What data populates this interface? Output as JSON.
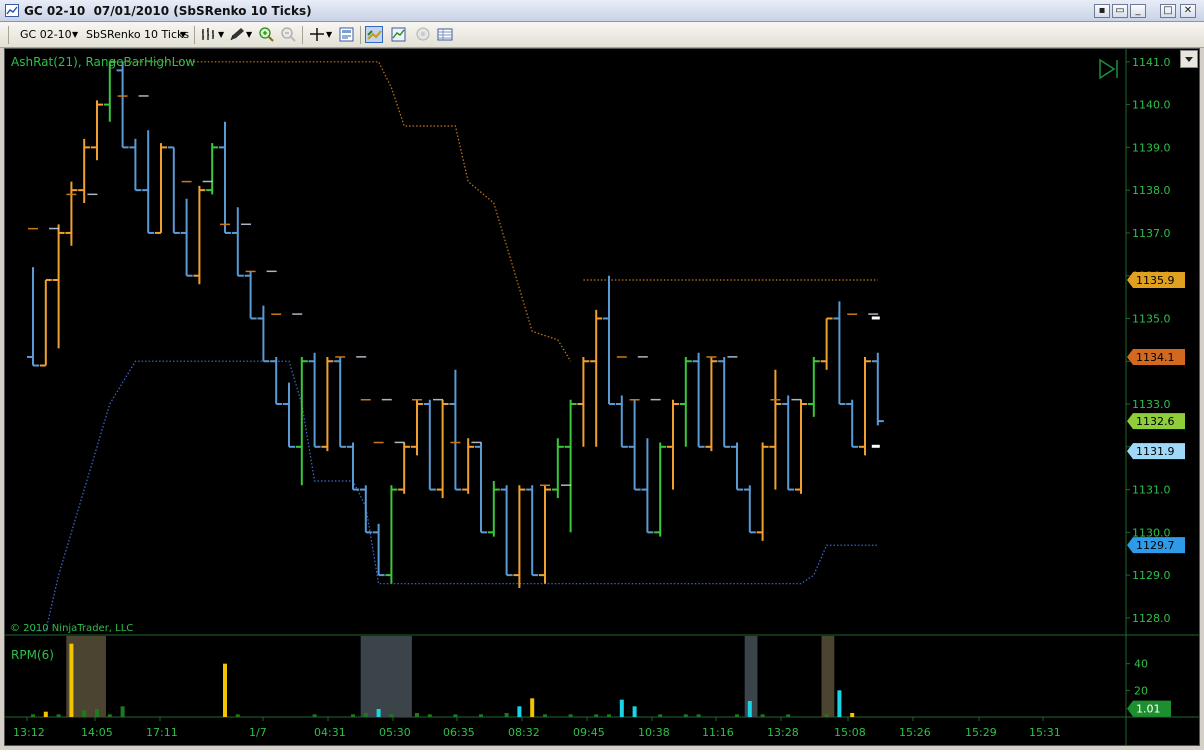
{
  "window": {
    "title": "GC 02-10  07/01/2010 (SbSRenko 10 Ticks)",
    "buttons": [
      "□",
      "▭",
      "✕"
    ]
  },
  "toolbar": {
    "instrument": "GC 02-10",
    "bar_type": "SbSRenko 10 Ticks"
  },
  "icons": [
    "chart-icon",
    "bar-style-icon",
    "drawing-tool-icon",
    "zoom-in-icon",
    "zoom-out-icon",
    "crosshair-icon",
    "properties-icon",
    "data-box-icon",
    "indicator-icon",
    "strategy-icon",
    "grid-icon"
  ],
  "panel_price": {
    "indicator_label": "AshRat(21), RangeBarHighLow",
    "copyright": "© 2010 NinjaTrader, LLC",
    "ticks": [
      "1141.0",
      "1140.0",
      "1139.0",
      "1138.0",
      "1137.0",
      "1136.0",
      "1135.0",
      "1134.0",
      "1133.0",
      "1132.0",
      "1131.0",
      "1130.0",
      "1129.0",
      "1128.0"
    ],
    "tags": [
      {
        "text": "1135.9",
        "color": "#e0a020"
      },
      {
        "text": "1134.1",
        "color": "#d2691e"
      },
      {
        "text": "1132.6",
        "color": "#8fce3a"
      },
      {
        "text": "1131.9",
        "color": "#9fd9f7"
      },
      {
        "text": "1129.7",
        "color": "#2f9be8"
      }
    ]
  },
  "panel_volume": {
    "label": "RPM(6)",
    "ticks": [
      "40",
      "20"
    ],
    "value_tag": "1.01"
  },
  "time_axis": [
    "13:12",
    "14:05",
    "17:11",
    "1/7",
    "04:31",
    "05:30",
    "06:35",
    "08:32",
    "09:45",
    "10:38",
    "11:16",
    "13:28",
    "15:08",
    "15:26",
    "15:29",
    "15:31"
  ],
  "chart_data": {
    "type": "ohlc",
    "y_range": [
      1127.6,
      1141.3
    ],
    "colors": {
      "up": "#f0a030",
      "down": "#5b9bd5",
      "strong_up": "#3cc83c",
      "hl_line": "#c97a18",
      "stop_line": "#3d6fd6",
      "axis_text": "#2fbf4a"
    },
    "bars": [
      {
        "o": 1134.1,
        "h": 1136.2,
        "l": 1133.9,
        "c": 1133.9
      },
      {
        "o": 1133.9,
        "h": 1135.9,
        "l": 1133.9,
        "c": 1135.9
      },
      {
        "o": 1135.9,
        "h": 1137.2,
        "l": 1134.3,
        "c": 1137.0
      },
      {
        "o": 1137.0,
        "h": 1138.2,
        "l": 1136.7,
        "c": 1138.0
      },
      {
        "o": 1138.0,
        "h": 1139.2,
        "l": 1137.7,
        "c": 1139.0
      },
      {
        "o": 1139.0,
        "h": 1140.1,
        "l": 1138.7,
        "c": 1140.0
      },
      {
        "o": 1140.0,
        "h": 1141.0,
        "l": 1139.6,
        "c": 1141.0
      },
      {
        "o": 1140.8,
        "h": 1141.0,
        "l": 1139.0,
        "c": 1139.0
      },
      {
        "o": 1139.0,
        "h": 1139.2,
        "l": 1138.0,
        "c": 1138.0
      },
      {
        "o": 1138.0,
        "h": 1139.4,
        "l": 1137.0,
        "c": 1137.0
      },
      {
        "o": 1137.0,
        "h": 1139.1,
        "l": 1137.0,
        "c": 1139.0
      },
      {
        "o": 1139.0,
        "h": 1139.0,
        "l": 1137.0,
        "c": 1137.0
      },
      {
        "o": 1137.0,
        "h": 1137.8,
        "l": 1136.0,
        "c": 1136.0
      },
      {
        "o": 1136.0,
        "h": 1138.1,
        "l": 1135.8,
        "c": 1138.0
      },
      {
        "o": 1138.0,
        "h": 1139.1,
        "l": 1137.9,
        "c": 1139.0
      },
      {
        "o": 1139.0,
        "h": 1139.6,
        "l": 1137.0,
        "c": 1137.0
      },
      {
        "o": 1137.0,
        "h": 1137.6,
        "l": 1136.0,
        "c": 1136.0
      },
      {
        "o": 1136.0,
        "h": 1136.1,
        "l": 1135.0,
        "c": 1135.0
      },
      {
        "o": 1135.0,
        "h": 1135.3,
        "l": 1134.0,
        "c": 1134.0
      },
      {
        "o": 1134.0,
        "h": 1134.1,
        "l": 1133.0,
        "c": 1133.0
      },
      {
        "o": 1133.0,
        "h": 1133.5,
        "l": 1132.0,
        "c": 1132.0
      },
      {
        "o": 1132.0,
        "h": 1134.1,
        "l": 1131.1,
        "c": 1134.0
      },
      {
        "o": 1134.0,
        "h": 1134.2,
        "l": 1132.0,
        "c": 1132.0
      },
      {
        "o": 1132.0,
        "h": 1134.1,
        "l": 1131.9,
        "c": 1134.0
      },
      {
        "o": 1134.0,
        "h": 1134.1,
        "l": 1132.0,
        "c": 1132.0
      },
      {
        "o": 1132.0,
        "h": 1132.1,
        "l": 1131.0,
        "c": 1131.0
      },
      {
        "o": 1131.0,
        "h": 1131.1,
        "l": 1130.0,
        "c": 1130.0
      },
      {
        "o": 1130.0,
        "h": 1130.2,
        "l": 1129.0,
        "c": 1129.0
      },
      {
        "o": 1129.0,
        "h": 1131.1,
        "l": 1128.8,
        "c": 1131.0
      },
      {
        "o": 1131.0,
        "h": 1132.1,
        "l": 1130.9,
        "c": 1132.0
      },
      {
        "o": 1132.0,
        "h": 1133.1,
        "l": 1131.8,
        "c": 1133.0
      },
      {
        "o": 1133.0,
        "h": 1133.1,
        "l": 1131.0,
        "c": 1131.0
      },
      {
        "o": 1131.0,
        "h": 1133.1,
        "l": 1130.8,
        "c": 1133.0
      },
      {
        "o": 1133.0,
        "h": 1133.8,
        "l": 1131.0,
        "c": 1131.0
      },
      {
        "o": 1131.0,
        "h": 1132.2,
        "l": 1130.9,
        "c": 1132.0
      },
      {
        "o": 1132.0,
        "h": 1132.1,
        "l": 1130.0,
        "c": 1130.0
      },
      {
        "o": 1130.0,
        "h": 1131.2,
        "l": 1129.9,
        "c": 1131.0
      },
      {
        "o": 1131.0,
        "h": 1131.1,
        "l": 1129.0,
        "c": 1129.0
      },
      {
        "o": 1129.0,
        "h": 1131.1,
        "l": 1128.7,
        "c": 1131.0
      },
      {
        "o": 1131.0,
        "h": 1131.1,
        "l": 1129.0,
        "c": 1129.0
      },
      {
        "o": 1129.0,
        "h": 1131.1,
        "l": 1128.8,
        "c": 1131.0
      },
      {
        "o": 1131.0,
        "h": 1132.2,
        "l": 1130.8,
        "c": 1132.0
      },
      {
        "o": 1132.0,
        "h": 1133.1,
        "l": 1130.0,
        "c": 1133.0
      },
      {
        "o": 1133.0,
        "h": 1134.1,
        "l": 1132.0,
        "c": 1134.0
      },
      {
        "o": 1134.0,
        "h": 1135.2,
        "l": 1132.0,
        "c": 1135.0
      },
      {
        "o": 1135.0,
        "h": 1136.0,
        "l": 1133.0,
        "c": 1133.0
      },
      {
        "o": 1133.0,
        "h": 1133.2,
        "l": 1132.0,
        "c": 1132.0
      },
      {
        "o": 1132.0,
        "h": 1133.1,
        "l": 1131.0,
        "c": 1131.0
      },
      {
        "o": 1131.0,
        "h": 1132.2,
        "l": 1130.0,
        "c": 1130.0
      },
      {
        "o": 1130.0,
        "h": 1132.1,
        "l": 1129.9,
        "c": 1132.0
      },
      {
        "o": 1132.0,
        "h": 1133.1,
        "l": 1131.0,
        "c": 1133.0
      },
      {
        "o": 1133.0,
        "h": 1134.1,
        "l": 1132.0,
        "c": 1134.0
      },
      {
        "o": 1134.0,
        "h": 1134.2,
        "l": 1132.0,
        "c": 1132.0
      },
      {
        "o": 1132.0,
        "h": 1134.1,
        "l": 1131.9,
        "c": 1134.0
      },
      {
        "o": 1134.0,
        "h": 1134.1,
        "l": 1132.0,
        "c": 1132.0
      },
      {
        "o": 1132.0,
        "h": 1132.1,
        "l": 1131.0,
        "c": 1131.0
      },
      {
        "o": 1131.0,
        "h": 1131.1,
        "l": 1130.0,
        "c": 1130.0
      },
      {
        "o": 1130.0,
        "h": 1132.1,
        "l": 1129.8,
        "c": 1132.0
      },
      {
        "o": 1132.0,
        "h": 1133.8,
        "l": 1131.0,
        "c": 1133.0
      },
      {
        "o": 1133.0,
        "h": 1133.2,
        "l": 1131.0,
        "c": 1131.0
      },
      {
        "o": 1131.0,
        "h": 1133.1,
        "l": 1130.9,
        "c": 1133.0
      },
      {
        "o": 1133.0,
        "h": 1134.1,
        "l": 1132.7,
        "c": 1134.0
      },
      {
        "o": 1134.0,
        "h": 1135.0,
        "l": 1133.8,
        "c": 1135.0
      },
      {
        "o": 1135.0,
        "h": 1135.4,
        "l": 1133.0,
        "c": 1133.0
      },
      {
        "o": 1133.0,
        "h": 1133.1,
        "l": 1132.0,
        "c": 1132.0
      },
      {
        "o": 1132.0,
        "h": 1134.1,
        "l": 1131.8,
        "c": 1134.0
      },
      {
        "o": 1134.0,
        "h": 1134.2,
        "l": 1132.5,
        "c": 1132.6
      }
    ],
    "hl_marks": [
      {
        "i": 0,
        "v": 1137.1
      },
      {
        "i": 3,
        "v": 1137.9
      },
      {
        "i": 7,
        "v": 1140.2
      },
      {
        "i": 12,
        "v": 1138.2
      },
      {
        "i": 15,
        "v": 1137.2
      },
      {
        "i": 17,
        "v": 1136.1
      },
      {
        "i": 19,
        "v": 1135.1
      },
      {
        "i": 24,
        "v": 1134.1
      },
      {
        "i": 26,
        "v": 1133.1
      },
      {
        "i": 27,
        "v": 1132.1
      },
      {
        "i": 30,
        "v": 1133.1
      },
      {
        "i": 33,
        "v": 1132.1
      },
      {
        "i": 40,
        "v": 1131.1
      },
      {
        "i": 46,
        "v": 1134.1
      },
      {
        "i": 47,
        "v": 1133.1
      },
      {
        "i": 53,
        "v": 1134.1
      },
      {
        "i": 58,
        "v": 1133.1
      },
      {
        "i": 64,
        "v": 1135.1
      }
    ],
    "upper_line": [
      {
        "i": 6,
        "v": 1141.0
      },
      {
        "i": 27,
        "v": 1141.0
      },
      {
        "i": 28,
        "v": 1140.4
      },
      {
        "i": 29,
        "v": 1139.5
      },
      {
        "i": 33,
        "v": 1139.5
      },
      {
        "i": 34,
        "v": 1138.2
      },
      {
        "i": 36,
        "v": 1137.7
      },
      {
        "i": 38,
        "v": 1135.7
      },
      {
        "i": 39,
        "v": 1134.7
      },
      {
        "i": 41,
        "v": 1134.5
      },
      {
        "i": 42,
        "v": 1134.0
      }
    ],
    "upper_line2": [
      {
        "i": 43,
        "v": 1135.9
      },
      {
        "i": 66,
        "v": 1135.9
      }
    ],
    "lower_line": [
      {
        "i": 0,
        "v": 1127.7
      },
      {
        "i": 1,
        "v": 1127.7
      },
      {
        "i": 2,
        "v": 1129.0
      },
      {
        "i": 3,
        "v": 1130.0
      },
      {
        "i": 4,
        "v": 1131.0
      },
      {
        "i": 5,
        "v": 1132.0
      },
      {
        "i": 6,
        "v": 1133.0
      },
      {
        "i": 7,
        "v": 1133.5
      },
      {
        "i": 8,
        "v": 1134.0
      },
      {
        "i": 20,
        "v": 1134.0
      },
      {
        "i": 21,
        "v": 1133.0
      },
      {
        "i": 22,
        "v": 1131.2
      },
      {
        "i": 25,
        "v": 1131.2
      },
      {
        "i": 26,
        "v": 1130.6
      },
      {
        "i": 27,
        "v": 1128.8
      },
      {
        "i": 60,
        "v": 1128.8
      },
      {
        "i": 61,
        "v": 1129.0
      },
      {
        "i": 62,
        "v": 1129.7
      },
      {
        "i": 66,
        "v": 1129.7
      }
    ],
    "rpm": [
      {
        "i": 0,
        "v": 2,
        "c": "#1f7a1f"
      },
      {
        "i": 1,
        "v": 4,
        "c": "#f5c400"
      },
      {
        "i": 2,
        "v": 2,
        "c": "#1f7a1f"
      },
      {
        "i": 3,
        "v": 55,
        "c": "#f5c400"
      },
      {
        "i": 4,
        "v": 5,
        "c": "#1f7a1f"
      },
      {
        "i": 5,
        "v": 6,
        "c": "#1f7a1f"
      },
      {
        "i": 6,
        "v": 2,
        "c": "#1f7a1f"
      },
      {
        "i": 7,
        "v": 8,
        "c": "#1f7a1f"
      },
      {
        "i": 15,
        "v": 40,
        "c": "#f5c400"
      },
      {
        "i": 16,
        "v": 2,
        "c": "#1f7a1f"
      },
      {
        "i": 22,
        "v": 2,
        "c": "#1f7a1f"
      },
      {
        "i": 25,
        "v": 2,
        "c": "#1f7a1f"
      },
      {
        "i": 26,
        "v": 3,
        "c": "#1f7a1f"
      },
      {
        "i": 27,
        "v": 6,
        "c": "#19d4e6"
      },
      {
        "i": 28,
        "v": 2,
        "c": "#1f7a1f"
      },
      {
        "i": 30,
        "v": 3,
        "c": "#1f7a1f"
      },
      {
        "i": 31,
        "v": 2,
        "c": "#1f7a1f"
      },
      {
        "i": 33,
        "v": 2,
        "c": "#1f7a1f"
      },
      {
        "i": 35,
        "v": 2,
        "c": "#1f7a1f"
      },
      {
        "i": 37,
        "v": 3,
        "c": "#1f7a1f"
      },
      {
        "i": 38,
        "v": 8,
        "c": "#19d4e6"
      },
      {
        "i": 39,
        "v": 14,
        "c": "#f5c400"
      },
      {
        "i": 40,
        "v": 2,
        "c": "#1f7a1f"
      },
      {
        "i": 42,
        "v": 2,
        "c": "#1f7a1f"
      },
      {
        "i": 44,
        "v": 2,
        "c": "#1f7a1f"
      },
      {
        "i": 45,
        "v": 2,
        "c": "#1f7a1f"
      },
      {
        "i": 46,
        "v": 13,
        "c": "#19d4e6"
      },
      {
        "i": 47,
        "v": 8,
        "c": "#19d4e6"
      },
      {
        "i": 49,
        "v": 2,
        "c": "#1f7a1f"
      },
      {
        "i": 51,
        "v": 2,
        "c": "#1f7a1f"
      },
      {
        "i": 52,
        "v": 2,
        "c": "#1f7a1f"
      },
      {
        "i": 55,
        "v": 2,
        "c": "#1f7a1f"
      },
      {
        "i": 56,
        "v": 12,
        "c": "#19d4e6"
      },
      {
        "i": 57,
        "v": 2,
        "c": "#1f7a1f"
      },
      {
        "i": 59,
        "v": 2,
        "c": "#1f7a1f"
      },
      {
        "i": 62,
        "v": 2,
        "c": "#1f7a1f"
      },
      {
        "i": 63,
        "v": 20,
        "c": "#19d4e6"
      },
      {
        "i": 64,
        "v": 3,
        "c": "#f5c400"
      }
    ],
    "rpm_highlights": [
      {
        "from": 2.6,
        "to": 5.7,
        "c": "#4a4430"
      },
      {
        "from": 25.6,
        "to": 29.6,
        "c": "#3b4449"
      },
      {
        "from": 55.6,
        "to": 56.6,
        "c": "#3b4449"
      },
      {
        "from": 61.6,
        "to": 62.6,
        "c": "#4a4430"
      }
    ]
  }
}
